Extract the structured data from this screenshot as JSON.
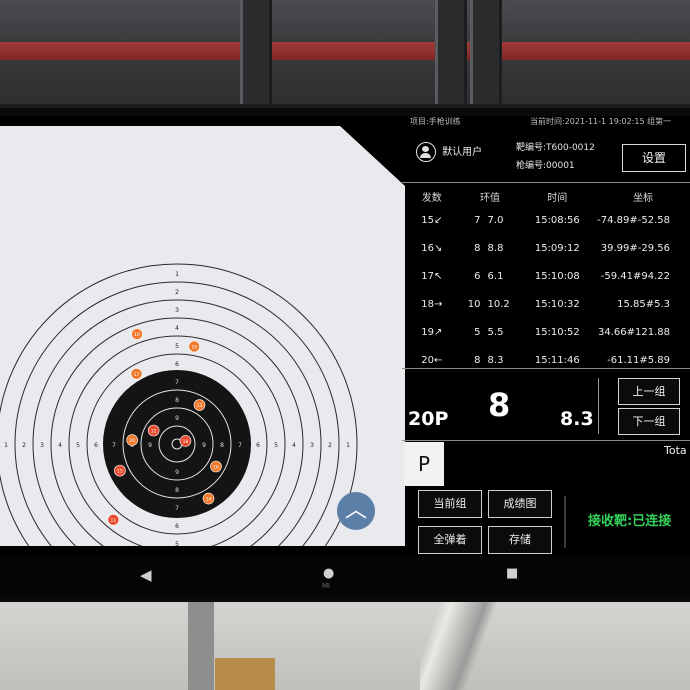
{
  "app": {
    "project_label": "项目:手枪训练",
    "current_time": "当前时间:2021-11-1 19:02:15",
    "group_label": "组第一",
    "user_name": "默认用户",
    "target_no": "靶编号:T600-0012",
    "gun_no": "枪编号:00001",
    "settings_label": "设置"
  },
  "table": {
    "headers": [
      "发数",
      "环值",
      "时间",
      "坐标"
    ],
    "rows": [
      {
        "shot": "15↙",
        "ring": "7",
        "score": "7.0",
        "time": "15:08:56",
        "coord": "-74.89#-52.58"
      },
      {
        "shot": "16↘",
        "ring": "8",
        "score": "8.8",
        "time": "15:09:12",
        "coord": "39.99#-29.56"
      },
      {
        "shot": "17↖",
        "ring": "6",
        "score": "6.1",
        "time": "15:10:08",
        "coord": "-59.41#94.22"
      },
      {
        "shot": "18→",
        "ring": "10",
        "score": "10.2",
        "time": "15:10:32",
        "coord": "15.85#5.3"
      },
      {
        "shot": "19↗",
        "ring": "5",
        "score": "5.5",
        "time": "15:10:52",
        "coord": "34.66#121.88"
      },
      {
        "shot": "20←",
        "ring": "8",
        "score": "8.3",
        "time": "15:11:46",
        "coord": "-61.11#5.89"
      }
    ]
  },
  "summary": {
    "series": "20P",
    "ring": "8",
    "score": "8.3",
    "prev_group": "上一组",
    "next_group": "下一组"
  },
  "mode": "P",
  "total_label": "Tota",
  "actions": {
    "current_group": "当前组",
    "results_chart": "成绩图",
    "all_shots": "全弹着",
    "save": "存储"
  },
  "status": "接收靶:已连接",
  "target": {
    "ring_labels": [
      "1",
      "2",
      "3",
      "4",
      "5",
      "6",
      "7",
      "8",
      "9"
    ],
    "shots": [
      {
        "label": "15",
        "ring": 7
      },
      {
        "label": "16",
        "ring": 8
      },
      {
        "label": "17",
        "ring": 6
      },
      {
        "label": "18",
        "ring": 10
      },
      {
        "label": "19",
        "ring": 5
      },
      {
        "label": "20",
        "ring": 8
      },
      {
        "label": "12",
        "ring": 9
      },
      {
        "label": "13",
        "ring": 8
      },
      {
        "label": "14",
        "ring": 7
      },
      {
        "label": "11",
        "ring": 5
      },
      {
        "label": "10",
        "ring": 4
      }
    ],
    "colors": {
      "shot": "#f07a2c",
      "shot_alt": "#e84a2e",
      "bull": "#141414",
      "paper": "#e9eaee"
    }
  },
  "scroll_icon": "chevron-up-icon",
  "nav": {
    "back": "◀",
    "home": "●",
    "recent": "■"
  },
  "brand": "MI"
}
